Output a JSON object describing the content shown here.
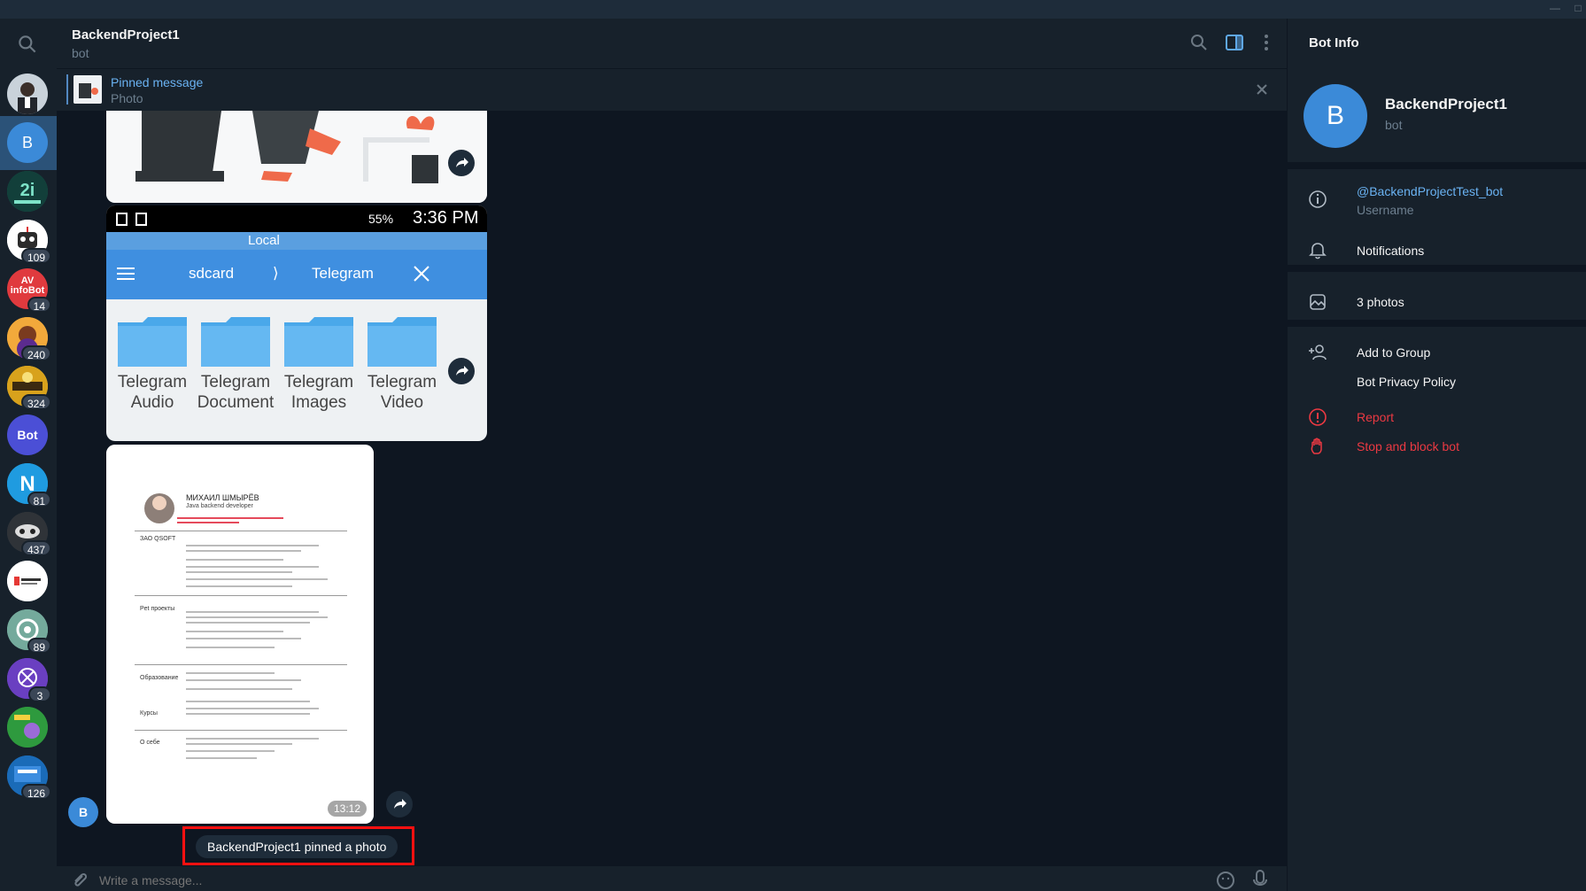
{
  "window": {
    "minimize_glyph": "—",
    "close_glyph": "□"
  },
  "chatlist": {
    "items": [
      {
        "name": "chat-1",
        "badge": ""
      },
      {
        "name": "chat-backendproject1",
        "letter": "B",
        "badge": ""
      },
      {
        "name": "chat-meet2peer",
        "badge": ""
      },
      {
        "name": "chat-robot",
        "badge": "109"
      },
      {
        "name": "chat-avinfobot",
        "label": "AV infoBot",
        "badge": "14"
      },
      {
        "name": "chat-5",
        "badge": "240"
      },
      {
        "name": "chat-6",
        "badge": "324"
      },
      {
        "name": "chat-bot",
        "label": "Bot",
        "badge": ""
      },
      {
        "name": "chat-n",
        "badge": "81"
      },
      {
        "name": "chat-9",
        "badge": "437"
      },
      {
        "name": "chat-10",
        "badge": ""
      },
      {
        "name": "chat-chatgpt",
        "badge": "89"
      },
      {
        "name": "chat-12",
        "badge": "3"
      },
      {
        "name": "chat-13",
        "badge": ""
      },
      {
        "name": "chat-14",
        "badge": "126"
      }
    ]
  },
  "header": {
    "title": "BackendProject1",
    "subtitle": "bot"
  },
  "pinned": {
    "title": "Pinned message",
    "subtitle": "Photo"
  },
  "messages": {
    "phone_screenshot": {
      "time": "3:36 PM",
      "battery": "55%",
      "tab_local": "Local",
      "path_root": "sdcard",
      "path_sep": "⟩",
      "path_current": "Telegram",
      "folders": [
        {
          "line1": "Telegram",
          "line2": "Audio"
        },
        {
          "line1": "Telegram",
          "line2": "Document"
        },
        {
          "line1": "Telegram",
          "line2": "Images"
        },
        {
          "line1": "Telegram",
          "line2": "Video"
        }
      ]
    },
    "resume": {
      "name": "МИХАИЛ ШМЫРЁВ",
      "role": "Java backend developer",
      "sections": [
        "ЗАО QSOFT",
        "Pet проекты",
        "Образование",
        "Курсы",
        "О себе"
      ],
      "time": "13:12"
    },
    "sender_letter": "B",
    "service_text": "BackendProject1 pinned a photo"
  },
  "composer": {
    "placeholder": "Write a message..."
  },
  "panel": {
    "title": "Bot Info",
    "avatar_letter": "B",
    "name": "BackendProject1",
    "subtitle": "bot",
    "username": "@BackendProjectTest_bot",
    "username_label": "Username",
    "notifications": "Notifications",
    "photos": "3 photos",
    "add_to_group": "Add to Group",
    "privacy": "Bot Privacy Policy",
    "report": "Report",
    "stop": "Stop and block bot"
  },
  "colors": {
    "accent": "#5288c1",
    "link": "#6ab2f2",
    "danger": "#ec3942",
    "background": "#0e1621",
    "surface": "#17212b"
  }
}
